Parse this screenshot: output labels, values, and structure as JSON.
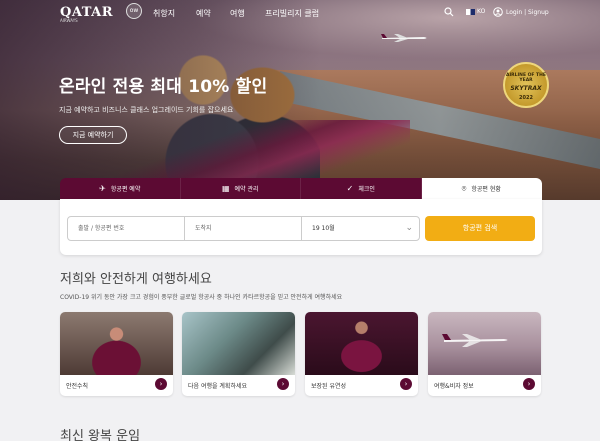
{
  "nav": {
    "logo": "QATAR",
    "logo_sub": "AIRWAYS",
    "oneworld": "ow",
    "items": [
      "취항지",
      "예약",
      "여행",
      "프리빌리지 클럽"
    ],
    "lang": "KO",
    "login": "Login | Signup",
    "icons": [
      "search-icon",
      "help-icon",
      "user-icon"
    ]
  },
  "hero": {
    "headline": "온라인 전용 최대 10% 할인",
    "subline": "지금 예약하고 비즈니스 클래스 업그레이드 기회를 잡으세요",
    "cta": "지금 예약하기",
    "award": {
      "line1": "AIRLINE OF THE YEAR",
      "line2": "SKYTRAX",
      "line3": "2022"
    }
  },
  "booking": {
    "tabs": [
      {
        "label": "항공편 예약",
        "icon": "plane-icon"
      },
      {
        "label": "예약 관리",
        "icon": "calendar-icon"
      },
      {
        "label": "체크인",
        "icon": "check-icon"
      },
      {
        "label": "항공편 현황",
        "icon": "location-icon"
      }
    ],
    "field1_placeholder": "출발 / 항공편 번호",
    "field2_placeholder": "도착지",
    "date_value": "19 10월",
    "search_label": "항공편 검색"
  },
  "safe": {
    "title": "저희와 안전하게 여행하세요",
    "desc": "COVID-19 위기 동안 가장 크고 경험이 풍부한 글로벌 항공사 중 하나인 카타르항공을 믿고 안전하게 여행하세요",
    "cards": [
      {
        "label": "안전수칙"
      },
      {
        "label": "다음 여행을 계획하세요"
      },
      {
        "label": "보장된 유연성"
      },
      {
        "label": "여행&비자 정보"
      }
    ]
  },
  "deals": {
    "title": "최신 왕복 운임"
  },
  "colors": {
    "brand": "#5c0a33",
    "accent": "#f2ad14"
  }
}
